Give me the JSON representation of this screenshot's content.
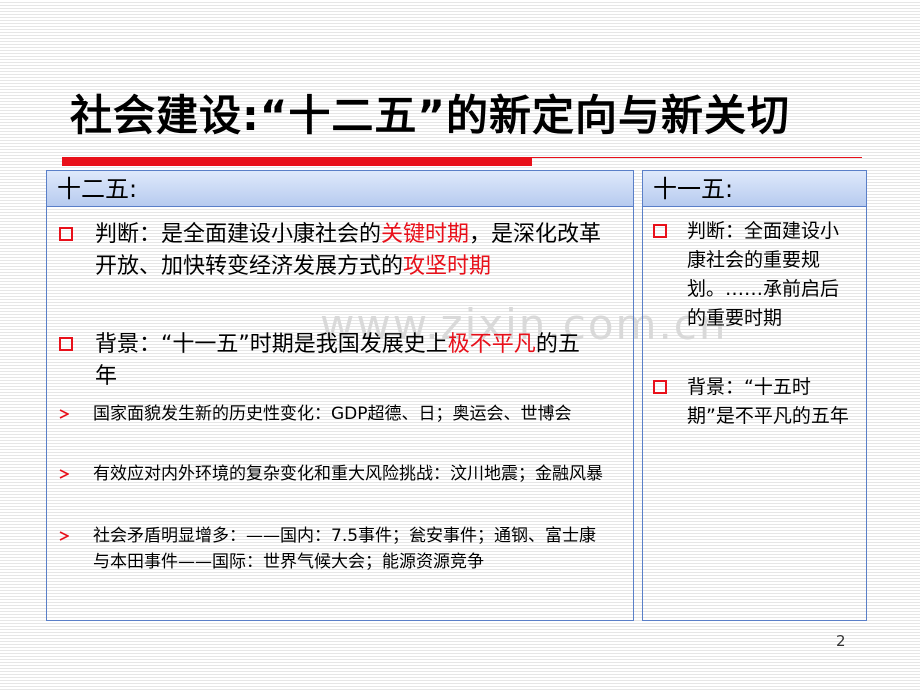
{
  "title": "社会建设:“十二五”的新定向与新关切",
  "watermark": "www.zixin.com.cn",
  "left_panel": {
    "header": "十二五:",
    "judgement": {
      "prefix": "判断：是全面建设小康社会的",
      "red1": "关键时期",
      "mid": "，是深化改革开放、加快转变经济发展方式的",
      "red2": "攻坚时期"
    },
    "background": {
      "prefix": "背景：“十一五”时期是我国发展史上",
      "red": "极不平凡",
      "suffix": "的五年"
    },
    "bullets": [
      "国家面貌发生新的历史性变化：GDP超德、日；奥运会、世博会",
      "有效应对内外环境的复杂变化和重大风险挑战：汶川地震；金融风暴",
      "社会矛盾明显增多：——国内：7.5事件；瓮安事件；通钢、富士康与本田事件——国际：世界气候大会；能源资源竞争"
    ]
  },
  "right_panel": {
    "header": "十一五:",
    "items": [
      "判断：全面建设小康社会的重要规划。……承前启后的重要时期",
      "背景：“十五时期”是不平凡的五年"
    ]
  },
  "page_number": "2",
  "colors": {
    "accent_red": "#e8101a",
    "panel_border": "#5a7fc8",
    "header_fill": "#c6d6f3"
  }
}
